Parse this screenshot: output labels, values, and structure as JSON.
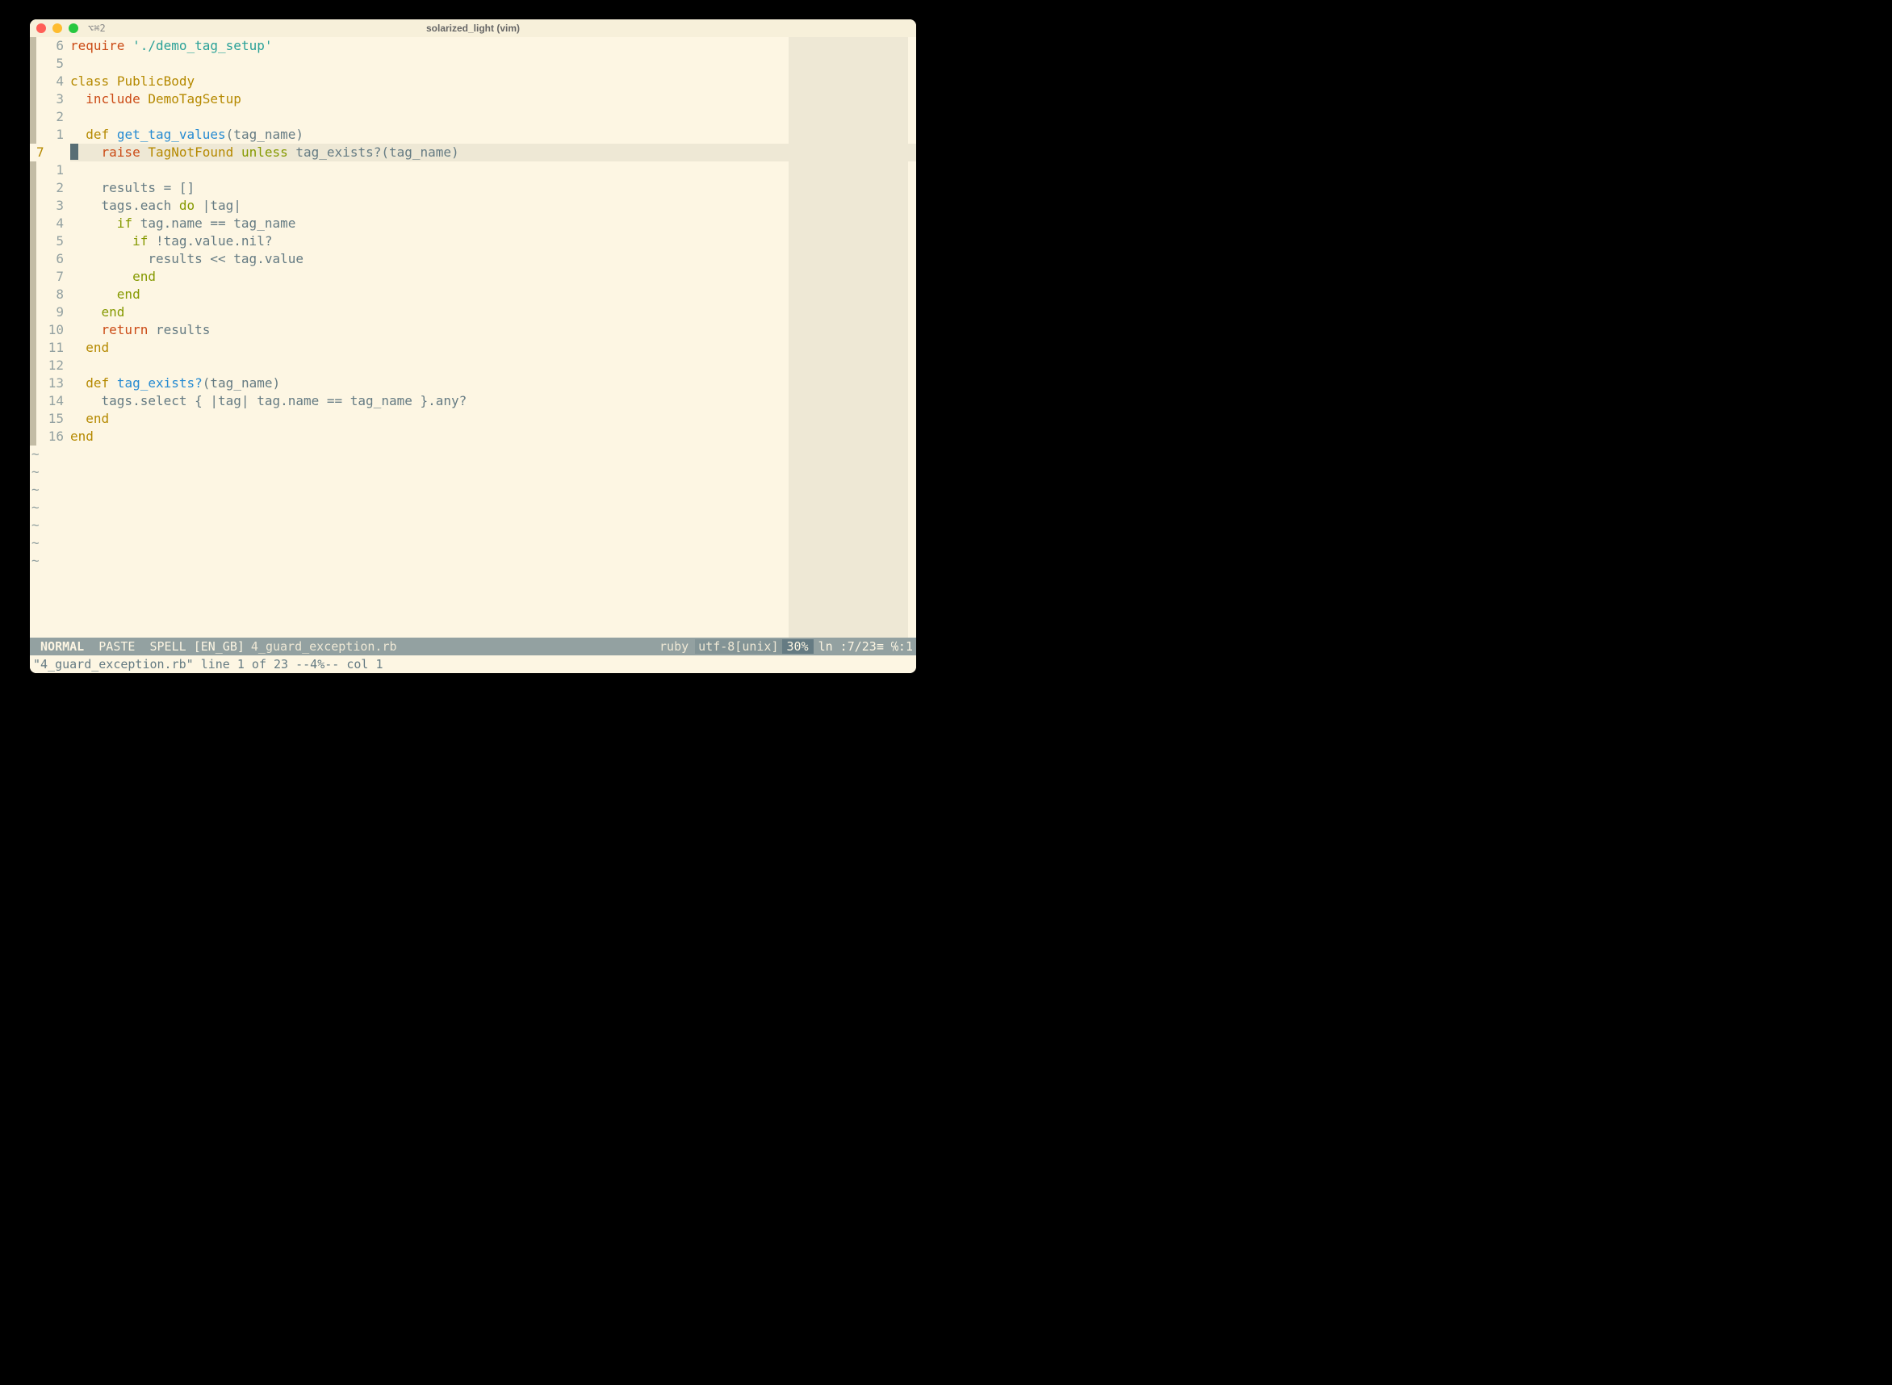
{
  "window": {
    "tab_indicator": "⌥⌘2",
    "title": "solarized_light (vim)"
  },
  "gutter": {
    "rel_numbers": [
      "6",
      "5",
      "4",
      "3",
      "2",
      "1",
      "7",
      "1",
      "2",
      "3",
      "4",
      "5",
      "6",
      "7",
      "8",
      "9",
      "10",
      "11",
      "12",
      "13",
      "14",
      "15",
      "16"
    ],
    "current_index": 6
  },
  "code": {
    "lines": [
      [
        [
          "kw-include",
          "require"
        ],
        [
          "operator",
          " "
        ],
        [
          "string",
          "'./demo_tag_setup'"
        ]
      ],
      [],
      [
        [
          "kw-class",
          "class"
        ],
        [
          "operator",
          " "
        ],
        [
          "const",
          "PublicBody"
        ]
      ],
      [
        [
          "operator",
          "  "
        ],
        [
          "kw-include",
          "include"
        ],
        [
          "operator",
          " "
        ],
        [
          "const",
          "DemoTagSetup"
        ]
      ],
      [],
      [
        [
          "operator",
          "  "
        ],
        [
          "kw-class",
          "def"
        ],
        [
          "operator",
          " "
        ],
        [
          "funcname",
          "get_tag_values"
        ],
        [
          "operator",
          "(tag_name)"
        ]
      ],
      [
        [
          "operator",
          "    "
        ],
        [
          "raise",
          "raise"
        ],
        [
          "operator",
          " "
        ],
        [
          "const",
          "TagNotFound"
        ],
        [
          "operator",
          " "
        ],
        [
          "keyword",
          "unless"
        ],
        [
          "operator",
          " tag_exists?(tag_name)"
        ]
      ],
      [],
      [
        [
          "operator",
          "    results = []"
        ]
      ],
      [
        [
          "operator",
          "    tags.each "
        ],
        [
          "keyword",
          "do"
        ],
        [
          "operator",
          " |tag|"
        ]
      ],
      [
        [
          "operator",
          "      "
        ],
        [
          "keyword",
          "if"
        ],
        [
          "operator",
          " tag.name == tag_name"
        ]
      ],
      [
        [
          "operator",
          "        "
        ],
        [
          "keyword",
          "if"
        ],
        [
          "operator",
          " !tag.value.nil?"
        ]
      ],
      [
        [
          "operator",
          "          results << tag.value"
        ]
      ],
      [
        [
          "operator",
          "        "
        ],
        [
          "keyword",
          "end"
        ]
      ],
      [
        [
          "operator",
          "      "
        ],
        [
          "keyword",
          "end"
        ]
      ],
      [
        [
          "operator",
          "    "
        ],
        [
          "keyword",
          "end"
        ]
      ],
      [
        [
          "operator",
          "    "
        ],
        [
          "kw-include",
          "return"
        ],
        [
          "operator",
          " results"
        ]
      ],
      [
        [
          "operator",
          "  "
        ],
        [
          "kw-class",
          "end"
        ]
      ],
      [],
      [
        [
          "operator",
          "  "
        ],
        [
          "kw-class",
          "def"
        ],
        [
          "operator",
          " "
        ],
        [
          "funcname",
          "tag_exists?"
        ],
        [
          "operator",
          "(tag_name)"
        ]
      ],
      [
        [
          "operator",
          "    tags.select { |tag| tag.name == tag_name }.any?"
        ]
      ],
      [
        [
          "operator",
          "  "
        ],
        [
          "kw-class",
          "end"
        ]
      ],
      [
        [
          "kw-class",
          "end"
        ]
      ]
    ],
    "tilde_count": 7
  },
  "statusline": {
    "mode": "NORMAL",
    "paste": "PASTE",
    "spell": "SPELL",
    "lang": "[EN_GB]",
    "filename": "4_guard_exception.rb",
    "filetype": "ruby",
    "encoding": "utf-8[unix]",
    "percent": "30%",
    "position": "ln :7/23≡ ℅:1"
  },
  "cmdline": {
    "text": "\"4_guard_exception.rb\" line 1 of 23 --4%-- col 1"
  }
}
